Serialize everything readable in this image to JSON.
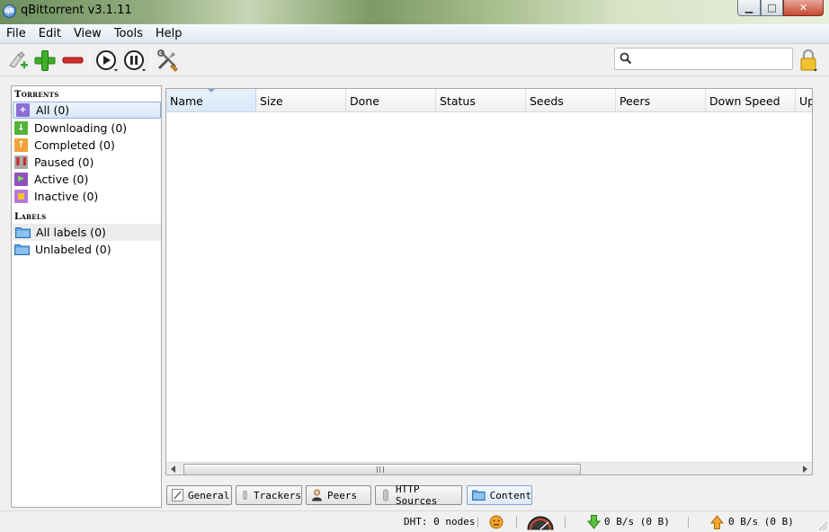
{
  "window": {
    "title": "qBittorrent v3.1.11",
    "app_icon_text": "qB",
    "controls": {
      "minimize": "▁",
      "maximize": "□",
      "close": "✕"
    }
  },
  "menu": [
    "File",
    "Edit",
    "View",
    "Tools",
    "Help"
  ],
  "toolbar": {
    "buttons": [
      "add-link-icon",
      "add-torrent-icon",
      "delete-icon",
      "resume-icon",
      "pause-icon",
      "options-icon"
    ],
    "search": {
      "value": "",
      "placeholder": ""
    },
    "lock": "lock-icon"
  },
  "sidebar": {
    "torrents_header": "Torrents",
    "torrents": [
      {
        "label": "All (0)",
        "icon": "all-icon",
        "color": "#8a6fd6",
        "selected": true
      },
      {
        "label": "Downloading (0)",
        "icon": "downloading-icon",
        "color": "#54b33d"
      },
      {
        "label": "Completed (0)",
        "icon": "completed-icon",
        "color": "#f0a23a"
      },
      {
        "label": "Paused (0)",
        "icon": "paused-icon",
        "color": "#a8a8a8"
      },
      {
        "label": "Active (0)",
        "icon": "active-icon",
        "color": "#8f4fbf"
      },
      {
        "label": "Inactive (0)",
        "icon": "inactive-icon",
        "color": "#b57ad8"
      }
    ],
    "labels_header": "Labels",
    "labels": [
      {
        "label": "All labels (0)",
        "icon": "folder-icon"
      },
      {
        "label": "Unlabeled (0)",
        "icon": "folder-icon"
      }
    ]
  },
  "table": {
    "columns": [
      "Name",
      "Size",
      "Done",
      "Status",
      "Seeds",
      "Peers",
      "Down Speed",
      "Up"
    ],
    "sorted_column": "Name",
    "rows": []
  },
  "tabs": [
    {
      "label": "General",
      "icon": "general-icon"
    },
    {
      "label": "Trackers",
      "icon": "trackers-icon"
    },
    {
      "label": "Peers",
      "icon": "peers-icon"
    },
    {
      "label": "HTTP Sources",
      "icon": "http-sources-icon"
    },
    {
      "label": "Content",
      "icon": "content-icon",
      "active": true
    }
  ],
  "status": {
    "dht": "DHT: 0 nodes",
    "download": "0 B/s (0 B)",
    "upload": "0 B/s (0 B)"
  }
}
